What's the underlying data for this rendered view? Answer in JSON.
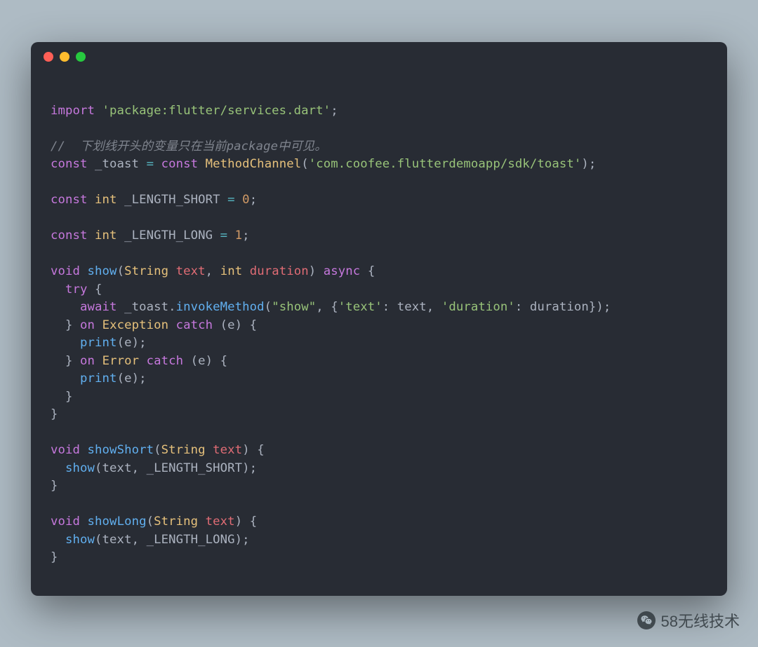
{
  "code": {
    "lines": [
      {
        "kind": "blank"
      },
      {
        "kind": "tokens",
        "t": [
          {
            "c": "k",
            "v": "import"
          },
          {
            "c": "p",
            "v": " "
          },
          {
            "c": "s",
            "v": "'package:flutter/services.dart'"
          },
          {
            "c": "p",
            "v": ";"
          }
        ]
      },
      {
        "kind": "blank"
      },
      {
        "kind": "tokens",
        "t": [
          {
            "c": "c",
            "v": "//  下划线开头的变量只在当前package中可见。"
          }
        ]
      },
      {
        "kind": "tokens",
        "t": [
          {
            "c": "k",
            "v": "const"
          },
          {
            "c": "p",
            "v": " _toast "
          },
          {
            "c": "a",
            "v": "="
          },
          {
            "c": "p",
            "v": " "
          },
          {
            "c": "k",
            "v": "const"
          },
          {
            "c": "p",
            "v": " "
          },
          {
            "c": "t",
            "v": "MethodChannel"
          },
          {
            "c": "p",
            "v": "("
          },
          {
            "c": "s",
            "v": "'com.coofee.flutterdemoapp/sdk/toast'"
          },
          {
            "c": "p",
            "v": ");"
          }
        ]
      },
      {
        "kind": "blank"
      },
      {
        "kind": "tokens",
        "t": [
          {
            "c": "k",
            "v": "const"
          },
          {
            "c": "p",
            "v": " "
          },
          {
            "c": "t",
            "v": "int"
          },
          {
            "c": "p",
            "v": " _LENGTH_SHORT "
          },
          {
            "c": "a",
            "v": "="
          },
          {
            "c": "p",
            "v": " "
          },
          {
            "c": "n",
            "v": "0"
          },
          {
            "c": "p",
            "v": ";"
          }
        ]
      },
      {
        "kind": "blank"
      },
      {
        "kind": "tokens",
        "t": [
          {
            "c": "k",
            "v": "const"
          },
          {
            "c": "p",
            "v": " "
          },
          {
            "c": "t",
            "v": "int"
          },
          {
            "c": "p",
            "v": " _LENGTH_LONG "
          },
          {
            "c": "a",
            "v": "="
          },
          {
            "c": "p",
            "v": " "
          },
          {
            "c": "n",
            "v": "1"
          },
          {
            "c": "p",
            "v": ";"
          }
        ]
      },
      {
        "kind": "blank"
      },
      {
        "kind": "tokens",
        "t": [
          {
            "c": "k",
            "v": "void"
          },
          {
            "c": "p",
            "v": " "
          },
          {
            "c": "f",
            "v": "show"
          },
          {
            "c": "p",
            "v": "("
          },
          {
            "c": "t",
            "v": "String"
          },
          {
            "c": "p",
            "v": " "
          },
          {
            "c": "v",
            "v": "text"
          },
          {
            "c": "p",
            "v": ", "
          },
          {
            "c": "t",
            "v": "int"
          },
          {
            "c": "p",
            "v": " "
          },
          {
            "c": "v",
            "v": "duration"
          },
          {
            "c": "p",
            "v": ") "
          },
          {
            "c": "k",
            "v": "async"
          },
          {
            "c": "p",
            "v": " {"
          }
        ]
      },
      {
        "kind": "tokens",
        "t": [
          {
            "c": "p",
            "v": "  "
          },
          {
            "c": "k",
            "v": "try"
          },
          {
            "c": "p",
            "v": " {"
          }
        ]
      },
      {
        "kind": "tokens",
        "t": [
          {
            "c": "p",
            "v": "    "
          },
          {
            "c": "k",
            "v": "await"
          },
          {
            "c": "p",
            "v": " _toast."
          },
          {
            "c": "f",
            "v": "invokeMethod"
          },
          {
            "c": "p",
            "v": "("
          },
          {
            "c": "s",
            "v": "\"show\""
          },
          {
            "c": "p",
            "v": ", {"
          },
          {
            "c": "s",
            "v": "'text'"
          },
          {
            "c": "p",
            "v": ": text, "
          },
          {
            "c": "s",
            "v": "'duration'"
          },
          {
            "c": "p",
            "v": ": duration});"
          }
        ]
      },
      {
        "kind": "tokens",
        "t": [
          {
            "c": "p",
            "v": "  } "
          },
          {
            "c": "k",
            "v": "on"
          },
          {
            "c": "p",
            "v": " "
          },
          {
            "c": "t",
            "v": "Exception"
          },
          {
            "c": "p",
            "v": " "
          },
          {
            "c": "k",
            "v": "catch"
          },
          {
            "c": "p",
            "v": " (e) {"
          }
        ]
      },
      {
        "kind": "tokens",
        "t": [
          {
            "c": "p",
            "v": "    "
          },
          {
            "c": "f",
            "v": "print"
          },
          {
            "c": "p",
            "v": "(e);"
          }
        ]
      },
      {
        "kind": "tokens",
        "t": [
          {
            "c": "p",
            "v": "  } "
          },
          {
            "c": "k",
            "v": "on"
          },
          {
            "c": "p",
            "v": " "
          },
          {
            "c": "t",
            "v": "Error"
          },
          {
            "c": "p",
            "v": " "
          },
          {
            "c": "k",
            "v": "catch"
          },
          {
            "c": "p",
            "v": " (e) {"
          }
        ]
      },
      {
        "kind": "tokens",
        "t": [
          {
            "c": "p",
            "v": "    "
          },
          {
            "c": "f",
            "v": "print"
          },
          {
            "c": "p",
            "v": "(e);"
          }
        ]
      },
      {
        "kind": "tokens",
        "t": [
          {
            "c": "p",
            "v": "  }"
          }
        ]
      },
      {
        "kind": "tokens",
        "t": [
          {
            "c": "p",
            "v": "}"
          }
        ]
      },
      {
        "kind": "blank"
      },
      {
        "kind": "tokens",
        "t": [
          {
            "c": "k",
            "v": "void"
          },
          {
            "c": "p",
            "v": " "
          },
          {
            "c": "f",
            "v": "showShort"
          },
          {
            "c": "p",
            "v": "("
          },
          {
            "c": "t",
            "v": "String"
          },
          {
            "c": "p",
            "v": " "
          },
          {
            "c": "v",
            "v": "text"
          },
          {
            "c": "p",
            "v": ") {"
          }
        ]
      },
      {
        "kind": "tokens",
        "t": [
          {
            "c": "p",
            "v": "  "
          },
          {
            "c": "f",
            "v": "show"
          },
          {
            "c": "p",
            "v": "(text, _LENGTH_SHORT);"
          }
        ]
      },
      {
        "kind": "tokens",
        "t": [
          {
            "c": "p",
            "v": "}"
          }
        ]
      },
      {
        "kind": "blank"
      },
      {
        "kind": "tokens",
        "t": [
          {
            "c": "k",
            "v": "void"
          },
          {
            "c": "p",
            "v": " "
          },
          {
            "c": "f",
            "v": "showLong"
          },
          {
            "c": "p",
            "v": "("
          },
          {
            "c": "t",
            "v": "String"
          },
          {
            "c": "p",
            "v": " "
          },
          {
            "c": "v",
            "v": "text"
          },
          {
            "c": "p",
            "v": ") {"
          }
        ]
      },
      {
        "kind": "tokens",
        "t": [
          {
            "c": "p",
            "v": "  "
          },
          {
            "c": "f",
            "v": "show"
          },
          {
            "c": "p",
            "v": "(text, _LENGTH_LONG);"
          }
        ]
      },
      {
        "kind": "tokens",
        "t": [
          {
            "c": "p",
            "v": "}"
          }
        ]
      }
    ]
  },
  "watermark": {
    "label": "58无线技术"
  }
}
